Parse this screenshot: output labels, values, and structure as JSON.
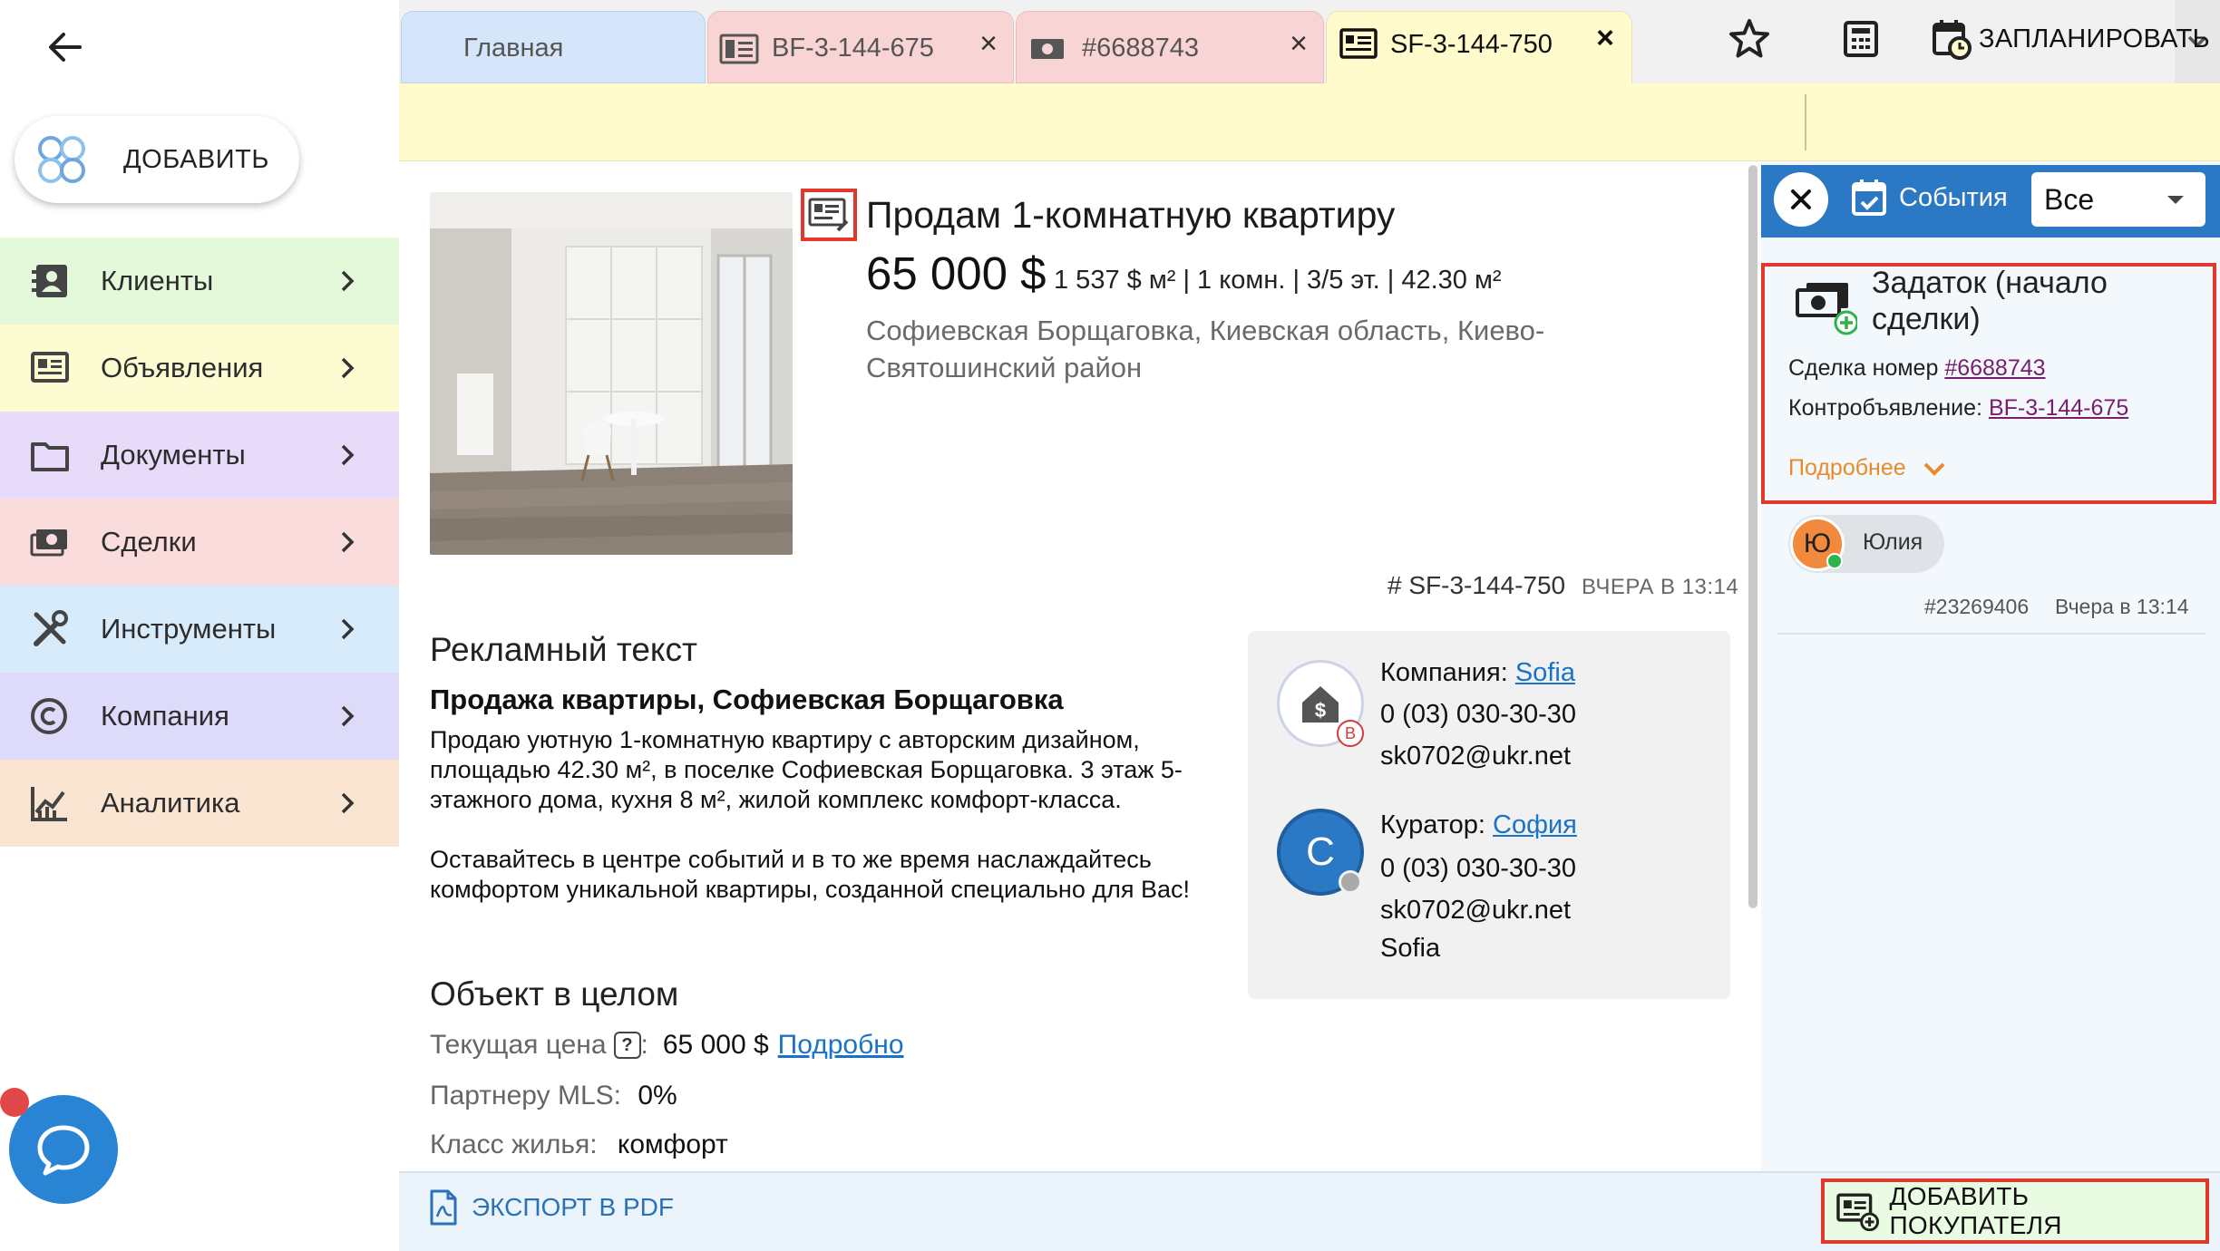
{
  "sidebar": {
    "add_label": "ДОБАВИТЬ",
    "items": [
      {
        "label": "Клиенты",
        "icon": "contacts-icon",
        "bg": "#e3f9d9"
      },
      {
        "label": "Объявления",
        "icon": "listing-icon",
        "bg": "#fcfbd2"
      },
      {
        "label": "Документы",
        "icon": "folder-icon",
        "bg": "#e8dbfa"
      },
      {
        "label": "Сделки",
        "icon": "cash-icon",
        "bg": "#fbdcdc"
      },
      {
        "label": "Инструменты",
        "icon": "tools-icon",
        "bg": "#d8ebfb"
      },
      {
        "label": "Компания",
        "icon": "copyright-icon",
        "bg": "#dddafa"
      },
      {
        "label": "Аналитика",
        "icon": "analytics-icon",
        "bg": "#fae5d3"
      }
    ]
  },
  "tabs": [
    {
      "label": "Главная",
      "color": "#d5e6fb",
      "icon": ""
    },
    {
      "label": "BF-3-144-675",
      "color": "#f9d4d4",
      "icon": "listing-icon"
    },
    {
      "label": "#6688743",
      "color": "#f9d4d4",
      "icon": "cash-icon"
    },
    {
      "label": "SF-3-144-750",
      "color": "#fffbcc",
      "icon": "listing-icon"
    }
  ],
  "toolbar": {
    "schedule_label": "ЗАПЛАНИРОВАТЬ"
  },
  "listing": {
    "title": "Продам 1-комнатную квартиру",
    "price": "65 000 $",
    "metrics": "1 537 $ м² | 1 комн. | 3/5 эт. | 42.30 м²",
    "address": "Софиевская Борщаговка, Киевская область, Киево-Святошинский район",
    "ref_code": "# SF-3-144-750",
    "ref_time": "ВЧЕРА В 13:14"
  },
  "ad": {
    "heading": "Рекламный текст",
    "subheading": "Продажа квартиры, Софиевская Борщаговка",
    "paragraph1": "Продаю уютную 1-комнатную квартиру с авторским дизайном, площадью 42.30 м², в поселке Софиевская Борщаговка. 3 этаж 5-этажного дома, кухня 8 м², жилой комплекс комфорт-класса.",
    "paragraph2": "Оставайтесь в центре событий и в то же время наслаждайтесь комфортом уникальной квартиры, созданной специально для Вас!"
  },
  "object": {
    "heading": "Объект в целом",
    "price_label": "Текущая цена",
    "help": "?",
    "price_sep": ":",
    "price_value": "65 000 $",
    "price_link": "Подробно",
    "mls_label": "Партнеру MLS:",
    "mls_value": "0%",
    "class_label": "Класс жилья:",
    "class_value": "комфорт"
  },
  "contact": {
    "company_label": "Компания:",
    "company_name": "Sofia",
    "company_badge": "B",
    "company_phone": "0 (03) 030-30-30",
    "company_email": "sk0702@ukr.net",
    "curator_label": "Куратор:",
    "curator_name": "София",
    "curator_initial": "C",
    "curator_phone": "0 (03) 030-30-30",
    "curator_email": "sk0702@ukr.net",
    "curator_company": "Sofia"
  },
  "events": {
    "label": "События",
    "filter_value": "Все",
    "card": {
      "title": "Задаток (начало сделки)",
      "deal_label": "Сделка номер",
      "deal_link": "#6688743",
      "counter_label": "Контробъявление:",
      "counter_link": "BF-3-144-675",
      "more_label": "Подробнее"
    },
    "author_initial": "Ю",
    "author_name": "Юлия",
    "event_id": "#23269406",
    "event_time": "Вчера в 13:14"
  },
  "bottom": {
    "export_label": "ЭКСПОРТ В PDF",
    "add_buyer_label": "ДОБАВИТЬ ПОКУПАТЕЛЯ"
  },
  "colors": {
    "accent_blue": "#2b78c4",
    "highlight_red": "#e0392b",
    "toolbar_yellow": "#fffbcc",
    "more_orange": "#e98a2c"
  }
}
